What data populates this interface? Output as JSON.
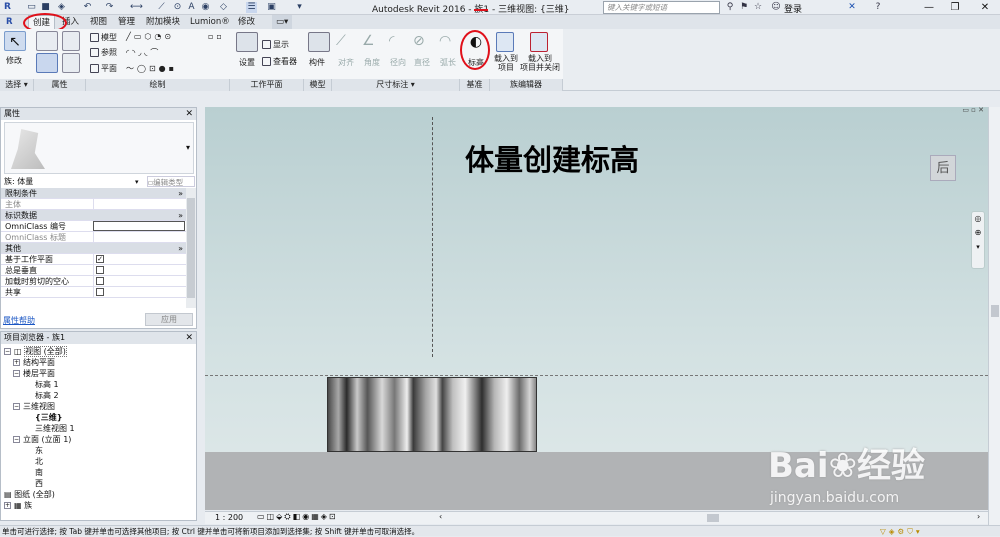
{
  "window": {
    "title": "Autodesk Revit 2016 -   族1 - 三维视图: {三维}"
  },
  "search": {
    "placeholder": "键入关键字或短语"
  },
  "user": {
    "login": "登录"
  },
  "tabs": [
    {
      "label": "创建"
    },
    {
      "label": "插入"
    },
    {
      "label": "视图"
    },
    {
      "label": "管理"
    },
    {
      "label": "附加模块"
    },
    {
      "label": "Lumion®"
    },
    {
      "label": "修改"
    }
  ],
  "ribbon": {
    "modify": "修改",
    "panels": {
      "select": "选择",
      "properties": "属性",
      "draw": "绘制",
      "workplane": "工作平面",
      "model": "模型",
      "dimension": "尺寸标注",
      "datum": "基准",
      "family_editor": "族编辑器"
    },
    "draw": {
      "model": "模型",
      "ref": "参照",
      "plane": "平面"
    },
    "workplane": {
      "set": "设置",
      "show": "显示",
      "viewer": "查看器"
    },
    "model": {
      "component": "构件"
    },
    "dimension": {
      "aligned": "对齐",
      "angle": "角度",
      "radial": "径向",
      "diameter": "直径",
      "arc": "弧长"
    },
    "datum": {
      "level": "标高"
    },
    "family_editor": {
      "load": "载入到",
      "load2": "项目",
      "load_close": "载入到",
      "load_close2": "项目并关闭"
    }
  },
  "properties": {
    "title": "属性",
    "family": "族: 体量",
    "edit_type": "编辑类型",
    "sections": {
      "constraints": "限制条件",
      "identity": "标识数据",
      "other": "其他"
    },
    "rows": {
      "host": "主体",
      "omniclass_num": "OmniClass 编号",
      "omniclass_title": "OmniClass 标题",
      "based_on_wp": "基于工作平面",
      "always_vertical": "总是垂直",
      "cut_with_voids": "加载时剪切的空心",
      "shared": "共享"
    },
    "help": "属性帮助",
    "apply": "应用"
  },
  "browser": {
    "title": "项目浏览器 - 族1",
    "nodes": [
      "视图 (全部)",
      "结构平面",
      "楼层平面",
      "标高 1",
      "标高 2",
      "三维视图",
      "{三维}",
      "三维视图 1",
      "立面 (立面 1)",
      "东",
      "北",
      "南",
      "西",
      "图纸 (全部)",
      "族"
    ]
  },
  "canvas": {
    "annotation": "体量创建标高",
    "viewcube": "后"
  },
  "view": {
    "scale": "1 : 200"
  },
  "status": {
    "text": "单击可进行选择; 按 Tab 键并单击可选择其他项目; 按 Ctrl 键并单击可将新项目添加到选择集; 按 Shift 键并单击可取消选择。"
  },
  "watermark": {
    "brand": "Bai",
    "brand2": "经验",
    "url": "jingyan.baidu.com"
  }
}
